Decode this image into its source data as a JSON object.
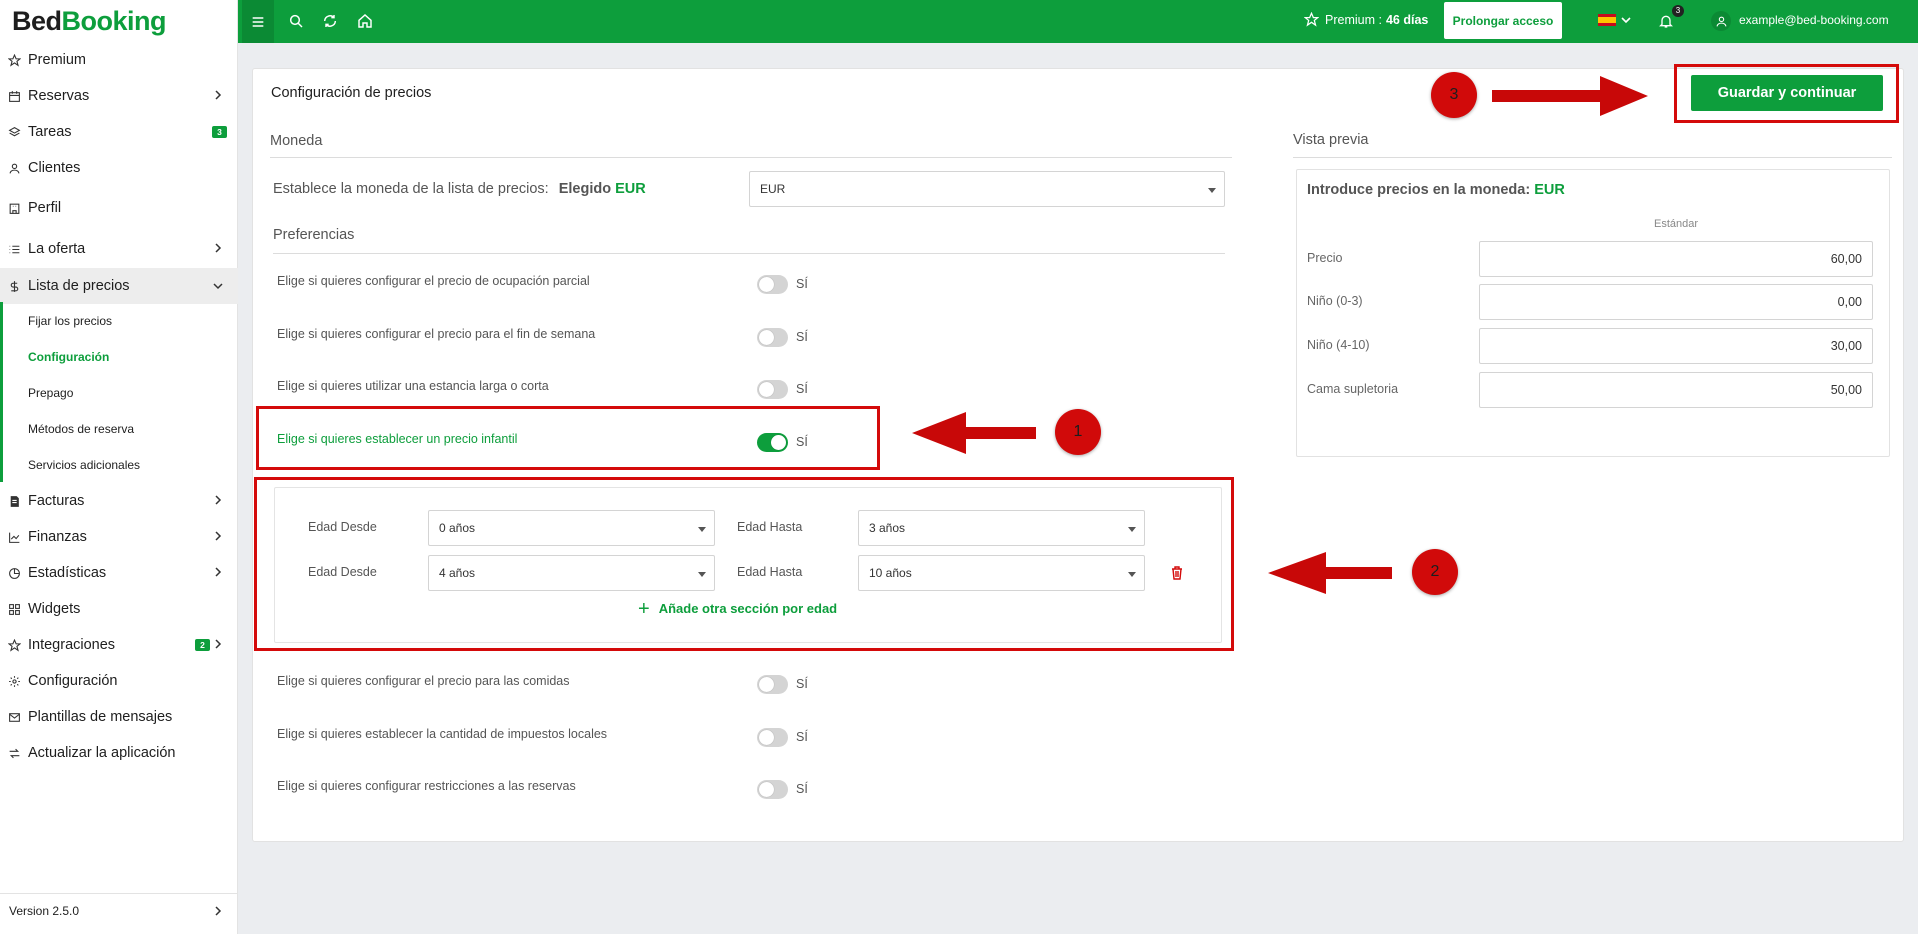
{
  "app": {
    "logo_part1": "Bed",
    "logo_part2": "Booking"
  },
  "sidebar": {
    "items": [
      {
        "label": "Premium",
        "icon": "star-icon"
      },
      {
        "label": "Reservas",
        "icon": "calendar-icon"
      },
      {
        "label": "Tareas",
        "icon": "layers-icon",
        "badge": "3"
      },
      {
        "label": "Clientes",
        "icon": "user-icon"
      },
      {
        "label": "Perfil",
        "icon": "building-icon"
      },
      {
        "label": "La oferta",
        "icon": "list-icon"
      },
      {
        "label": "Lista de precios",
        "icon": "dollar-icon"
      },
      {
        "label": "Facturas",
        "icon": "invoice-icon"
      },
      {
        "label": "Finanzas",
        "icon": "chart-line-icon"
      },
      {
        "label": "Estadísticas",
        "icon": "pie-chart-icon"
      },
      {
        "label": "Widgets",
        "icon": "grid-icon"
      },
      {
        "label": "Integraciones",
        "icon": "star-icon",
        "badge": "2"
      },
      {
        "label": "Configuración",
        "icon": "gear-icon"
      },
      {
        "label": "Plantillas de mensajes",
        "icon": "mail-icon"
      },
      {
        "label": "Actualizar la aplicación",
        "icon": "refresh-icon"
      }
    ],
    "sub_items": [
      "Fijar los precios",
      "Configuración",
      "Prepago",
      "Métodos de reserva",
      "Servicios adicionales"
    ],
    "version": "Version 2.5.0"
  },
  "topbar": {
    "premium_label": "Premium :",
    "premium_days": "46 días",
    "prolong_button": "Prolongar acceso",
    "notifications_count": "3",
    "user_email": "example@bed-booking.com"
  },
  "main": {
    "title": "Configuración de precios",
    "save_button": "Guardar y continuar",
    "currency_section": "Moneda",
    "currency_label": "Establece la moneda de la lista de precios:",
    "currency_chosen_label": "Elegido",
    "currency_chosen_value": "EUR",
    "currency_select": "EUR",
    "preferences_section": "Preferencias",
    "yes_label": "SÍ",
    "preferences": [
      {
        "label": "Elige si quieres configurar el precio de ocupación parcial",
        "on": false
      },
      {
        "label": "Elige si quieres configurar el precio para el fin de semana",
        "on": false
      },
      {
        "label": "Elige si quieres utilizar una estancia larga o corta",
        "on": false
      },
      {
        "label": "Elige si quieres establecer un precio infantil",
        "on": true
      },
      {
        "label": "Elige si quieres configurar el precio para las comidas",
        "on": false
      },
      {
        "label": "Elige si quieres establecer la cantidad de impuestos locales",
        "on": false
      },
      {
        "label": "Elige si quieres configurar restricciones a las reservas",
        "on": false
      }
    ],
    "age_from_label": "Edad Desde",
    "age_to_label": "Edad Hasta",
    "age_rows": [
      {
        "from": "0 años",
        "to": "3 años"
      },
      {
        "from": "4 años",
        "to": "10 años"
      }
    ],
    "add_age_section": "Añade otra sección por edad"
  },
  "preview": {
    "section": "Vista previa",
    "intro_label": "Introduce precios en la moneda:",
    "intro_currency": "EUR",
    "column_header": "Estándar",
    "rows": [
      {
        "label": "Precio",
        "value": "60,00"
      },
      {
        "label": "Niño (0-3)",
        "value": "0,00"
      },
      {
        "label": "Niño (4-10)",
        "value": "30,00"
      },
      {
        "label": "Cama supletoria",
        "value": "50,00"
      }
    ]
  },
  "annotations": {
    "step1": "1",
    "step2": "2",
    "step3": "3"
  },
  "colors": {
    "brand": "#0d9e3c",
    "annotation": "#d10a0a"
  }
}
